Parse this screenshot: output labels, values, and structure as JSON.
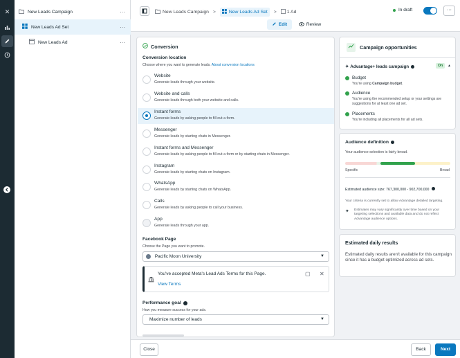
{
  "rail": {
    "close_icon": "✕",
    "chart_icon": "chart-icon",
    "edit_icon": "pencil-icon",
    "history_icon": "clock-icon"
  },
  "tree": {
    "campaign": "New Leads Campaign",
    "adset": "New Leads Ad Set",
    "ad": "New Leads Ad",
    "more": "···"
  },
  "topbar": {
    "crumb_campaign": "New Leads Campaign",
    "crumb_adset": "New Leads Ad Set",
    "crumb_ad": "1 Ad",
    "sep": ">",
    "status": "In draft",
    "more": "···",
    "edit_label": "Edit",
    "review_label": "Review"
  },
  "form": {
    "section_title": "Conversion",
    "location_title": "Conversion location",
    "location_help": "Choose where you want to generate leads.",
    "location_link": "About conversion locations",
    "options": [
      {
        "title": "Website",
        "desc": "Generate leads through your website."
      },
      {
        "title": "Website and calls",
        "desc": "Generate leads through both your website and calls."
      },
      {
        "title": "Instant forms",
        "desc": "Generate leads by asking people to fill out a form."
      },
      {
        "title": "Messenger",
        "desc": "Generate leads by starting chats in Messenger."
      },
      {
        "title": "Instant forms and Messenger",
        "desc": "Generate leads by asking people to fill out a form or by starting chats in Messenger."
      },
      {
        "title": "Instagram",
        "desc": "Generate leads by starting chats on Instagram."
      },
      {
        "title": "WhatsApp",
        "desc": "Generate leads by starting chats on WhatsApp."
      },
      {
        "title": "Calls",
        "desc": "Generate leads by asking people to call your business."
      },
      {
        "title": "App",
        "desc": "Generate leads through your app."
      }
    ],
    "selected_index": 2,
    "page_title": "Facebook Page",
    "page_help": "Choose the Page you want to promote.",
    "page_value": "Pacific Moon University",
    "terms_text": "You've accepted Meta's Lead Ads Terms for this Page.",
    "terms_link": "View Terms",
    "goal_title": "Performance goal",
    "goal_help": "How you measure success for your ads.",
    "goal_value": "Maximize number of leads"
  },
  "opportunities": {
    "title": "Campaign opportunities",
    "advantage_label": "Advantage+ leads campaign",
    "advantage_state": "On",
    "items": [
      {
        "title": "Budget",
        "desc_prefix": "You're using ",
        "desc_bold": "Campaign budget",
        "desc_suffix": "."
      },
      {
        "title": "Audience",
        "desc_prefix": "You're using the recommended setup or your settings are suggestions for at least one ad set.",
        "desc_bold": "",
        "desc_suffix": ""
      },
      {
        "title": "Placements",
        "desc_prefix": "You're including all placements for all ad sets.",
        "desc_bold": "",
        "desc_suffix": ""
      }
    ]
  },
  "audience": {
    "title": "Audience definition",
    "desc": "Your audience selection is fairly broad.",
    "specific": "Specific",
    "broad": "Broad",
    "size_label": "Estimated audience size:",
    "size_value": "767,300,000 - 902,700,000",
    "criteria": "Your criteria is currently set to allow Advantage detailed targeting.",
    "estimates_note": "Estimates may vary significantly over time based on your targeting selections and available data and do not reflect Advantage audience options."
  },
  "daily": {
    "title": "Estimated daily results",
    "desc": "Estimated daily results aren't available for this campaign since it has a budget optimized across ad sets."
  },
  "footer": {
    "close": "Close",
    "back": "Back",
    "next": "Next"
  },
  "colors": {
    "accent": "#0a78be",
    "selected_bg": "#e7f3fb",
    "green": "#31a24c",
    "dark": "#1c2b33"
  }
}
